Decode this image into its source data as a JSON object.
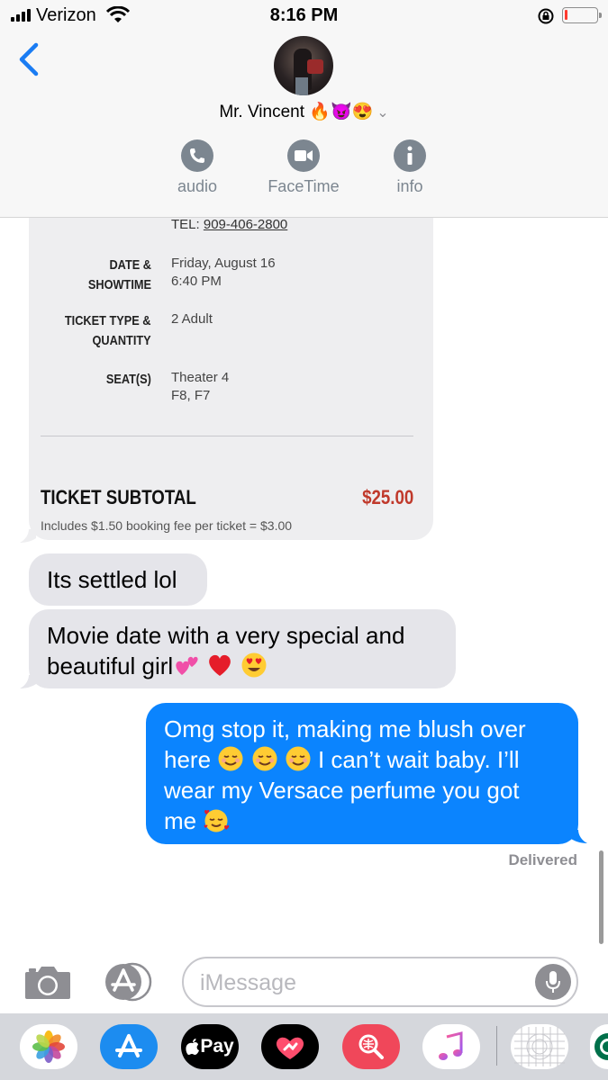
{
  "status_bar": {
    "carrier": "Verizon",
    "time": "8:16 PM",
    "battery_level": 0.08
  },
  "header": {
    "contact_name": "Mr. Vincent 🔥😈😍",
    "actions": [
      {
        "label": "audio",
        "icon": "phone-icon"
      },
      {
        "label": "FaceTime",
        "icon": "video-camera-icon"
      },
      {
        "label": "info",
        "icon": "info-icon"
      }
    ]
  },
  "ticket": {
    "tel_label": "TEL: ",
    "tel_number": "909-406-2800",
    "rows": [
      {
        "label": "DATE & SHOWTIME",
        "value_line1": "Friday, August 16",
        "value_line2": "6:40 PM"
      },
      {
        "label_line1": "TICKET TYPE &",
        "label_line2": "QUANTITY",
        "value": "2 Adult"
      },
      {
        "label": "SEAT(S)",
        "value_line1": "Theater 4",
        "value_line2": "F8, F7"
      }
    ],
    "subtotal_label": "TICKET SUBTOTAL",
    "subtotal_value": "$25.00",
    "fee_note": "Includes $1.50 booking fee per ticket = $3.00"
  },
  "messages": [
    {
      "direction": "incoming",
      "text": "Its settled lol"
    },
    {
      "direction": "incoming",
      "line1": "Movie date with a very special and",
      "line2": "beautiful girl"
    },
    {
      "direction": "outgoing",
      "line1": "Omg stop it, making me blush over",
      "line2_a": "here",
      "line2_b": "I can’t wait baby. I’ll",
      "line3": "wear my Versace perfume you got",
      "line4": "me"
    }
  ],
  "delivered_status": "Delivered",
  "composer": {
    "placeholder": "iMessage"
  },
  "app_tray": {
    "apps": [
      "photos-icon",
      "app-store-icon",
      "apple-pay-icon",
      "digital-touch-icon",
      "image-search-icon",
      "music-icon",
      "stickers-icon",
      "starbucks-icon"
    ],
    "apple_pay_label": "Pay"
  },
  "colors": {
    "imessage_blue": "#0b84fe",
    "incoming_gray": "#e5e5ea",
    "accent_blue": "#1a7cf3",
    "subtotal_red": "#c0392b"
  }
}
